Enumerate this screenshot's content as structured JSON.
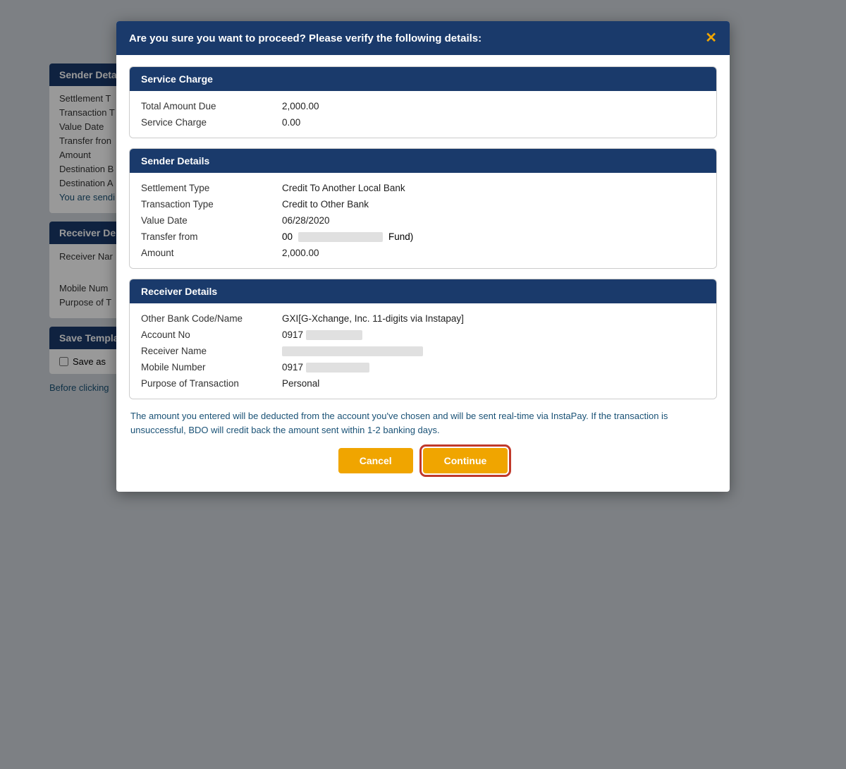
{
  "background": {
    "sender_section": {
      "header": "Sender Deta",
      "rows": [
        {
          "label": "Settlement T"
        },
        {
          "label": "Transaction T"
        },
        {
          "label": "Value Date"
        },
        {
          "label": "Transfer fron"
        },
        {
          "label": "Amount"
        },
        {
          "label": "Destination B"
        },
        {
          "label": "Destination A"
        },
        {
          "label": "you_are_sending",
          "value": "You are sendi"
        }
      ]
    },
    "receiver_section": {
      "header": "Receiver De",
      "rows": [
        {
          "label": "Receiver Nar"
        },
        {
          "label": ""
        },
        {
          "label": "Mobile Num"
        },
        {
          "label": "Purpose of T"
        }
      ]
    },
    "save_template": {
      "header": "Save Templa",
      "save_as_label": "Save as"
    },
    "before_clicking": "Before clicking"
  },
  "modal": {
    "header": "Are you sure you want to proceed? Please verify the following details:",
    "close_icon": "✕",
    "service_charge_section": {
      "header": "Service Charge",
      "rows": [
        {
          "label": "Total Amount Due",
          "value": "2,000.00"
        },
        {
          "label": "Service Charge",
          "value": "0.00"
        }
      ]
    },
    "sender_details_section": {
      "header": "Sender Details",
      "rows": [
        {
          "label": "Settlement Type",
          "value": "Credit To Another Local Bank",
          "redacted": false
        },
        {
          "label": "Transaction Type",
          "value": "Credit to Other Bank",
          "redacted": false
        },
        {
          "label": "Value Date",
          "value": "06/28/2020",
          "redacted": false
        },
        {
          "label": "Transfer from",
          "value": "00",
          "suffix": "Fund)",
          "redacted_width": 120
        },
        {
          "label": "Amount",
          "value": "2,000.00",
          "redacted": false
        }
      ]
    },
    "receiver_details_section": {
      "header": "Receiver Details",
      "rows": [
        {
          "label": "Other Bank Code/Name",
          "value": "GXI[G-Xchange, Inc. 11-digits via Instapay]",
          "redacted": false
        },
        {
          "label": "Account No",
          "value": "0917",
          "redacted_width": 80
        },
        {
          "label": "Receiver Name",
          "value": "",
          "redacted_width": 200
        },
        {
          "label": "Mobile Number",
          "value": "0917",
          "redacted_width": 90
        },
        {
          "label": "Purpose of Transaction",
          "value": "Personal",
          "redacted": false
        }
      ]
    },
    "instapay_notice": "The amount you entered will be deducted from the account you've chosen and will be sent real-time via InstaPay. If the transaction is unsuccessful, BDO will credit back the amount sent within 1-2 banking days.",
    "buttons": {
      "cancel": "Cancel",
      "continue": "Continue"
    }
  }
}
